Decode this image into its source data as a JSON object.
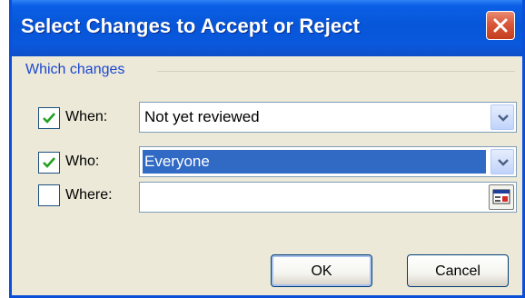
{
  "window": {
    "title": "Select Changes to Accept or Reject"
  },
  "group": {
    "label": "Which changes"
  },
  "when": {
    "label": "When:",
    "checked": true,
    "value": "Not yet reviewed"
  },
  "who": {
    "label": "Who:",
    "checked": true,
    "value": "Everyone"
  },
  "where": {
    "label": "Where:",
    "checked": false,
    "value": ""
  },
  "buttons": {
    "ok": "OK",
    "cancel": "Cancel"
  },
  "colors": {
    "titlebar": "#0756d8",
    "dialog_bg": "#ece9d8",
    "close": "#d9573a",
    "selection": "#316ac5",
    "group_label": "#1c47d1"
  },
  "icons": {
    "close": "close-icon",
    "dropdown": "chevron-down-icon",
    "checkmark": "checkmark-icon",
    "range_selector": "range-selector-icon"
  }
}
